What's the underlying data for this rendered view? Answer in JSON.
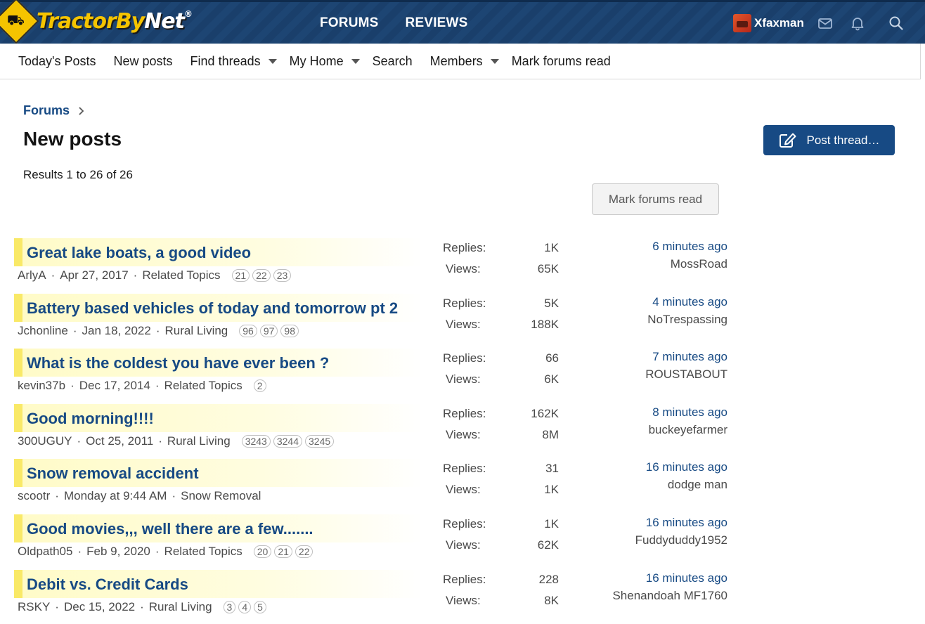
{
  "header": {
    "logo": {
      "primary": "TractorBy",
      "secondary": "Net",
      "trademark": "®"
    },
    "tabs": [
      "FORUMS",
      "REVIEWS"
    ],
    "user_name": "Xfaxman",
    "icons": [
      "envelope-icon",
      "bell-icon",
      "search-icon"
    ],
    "colors": {
      "bar": "#1a3f6b",
      "logo_yellow": "#f5c400"
    }
  },
  "subnav": {
    "todays_posts": "Today's Posts",
    "new_posts": "New posts",
    "find_threads": "Find threads",
    "my_home": "My Home",
    "search": "Search",
    "members": "Members",
    "mark_forums_read": "Mark forums read"
  },
  "page": {
    "breadcrumb": "Forums",
    "title": "New posts",
    "post_thread": "Post thread…",
    "results": "Results 1 to 26 of 26",
    "mark_forums_read": "Mark forums read",
    "accent": "#174a84"
  },
  "labels": {
    "replies": "Replies:",
    "views": "Views:"
  },
  "threads": [
    {
      "title": "Great lake boats, a good video",
      "author": "ArlyA",
      "date": "Apr 27, 2017",
      "forum": "Related Topics",
      "pages": [
        "21",
        "22",
        "23"
      ],
      "replies": "1K",
      "views": "65K",
      "last_time": "6 minutes ago",
      "last_user": "MossRoad"
    },
    {
      "title": "Battery based vehicles of today and tomorrow pt 2",
      "author": "Jchonline",
      "date": "Jan 18, 2022",
      "forum": "Rural Living",
      "pages": [
        "96",
        "97",
        "98"
      ],
      "replies": "5K",
      "views": "188K",
      "last_time": "4 minutes ago",
      "last_user": "NoTrespassing"
    },
    {
      "title": "What is the coldest you have ever been ?",
      "author": "kevin37b",
      "date": "Dec 17, 2014",
      "forum": "Related Topics",
      "pages": [
        "2"
      ],
      "replies": "66",
      "views": "6K",
      "last_time": "7 minutes ago",
      "last_user": "ROUSTABOUT"
    },
    {
      "title": "Good morning!!!!",
      "author": "300UGUY",
      "date": "Oct 25, 2011",
      "forum": "Rural Living",
      "pages": [
        "3243",
        "3244",
        "3245"
      ],
      "replies": "162K",
      "views": "8M",
      "last_time": "8 minutes ago",
      "last_user": "buckeyefarmer"
    },
    {
      "title": "Snow removal accident",
      "author": "scootr",
      "date": "Monday at 9:44 AM",
      "forum": "Snow Removal",
      "pages": [],
      "replies": "31",
      "views": "1K",
      "last_time": "16 minutes ago",
      "last_user": "dodge man"
    },
    {
      "title": "Good movies,,, well there are a few.......",
      "author": "Oldpath05",
      "date": "Feb 9, 2020",
      "forum": "Related Topics",
      "pages": [
        "20",
        "21",
        "22"
      ],
      "replies": "1K",
      "views": "62K",
      "last_time": "16 minutes ago",
      "last_user": "Fuddyduddy1952"
    },
    {
      "title": "Debit vs. Credit Cards",
      "author": "RSKY",
      "date": "Dec 15, 2022",
      "forum": "Rural Living",
      "pages": [
        "3",
        "4",
        "5"
      ],
      "replies": "228",
      "views": "8K",
      "last_time": "16 minutes ago",
      "last_user": "Shenandoah MF1760"
    }
  ]
}
